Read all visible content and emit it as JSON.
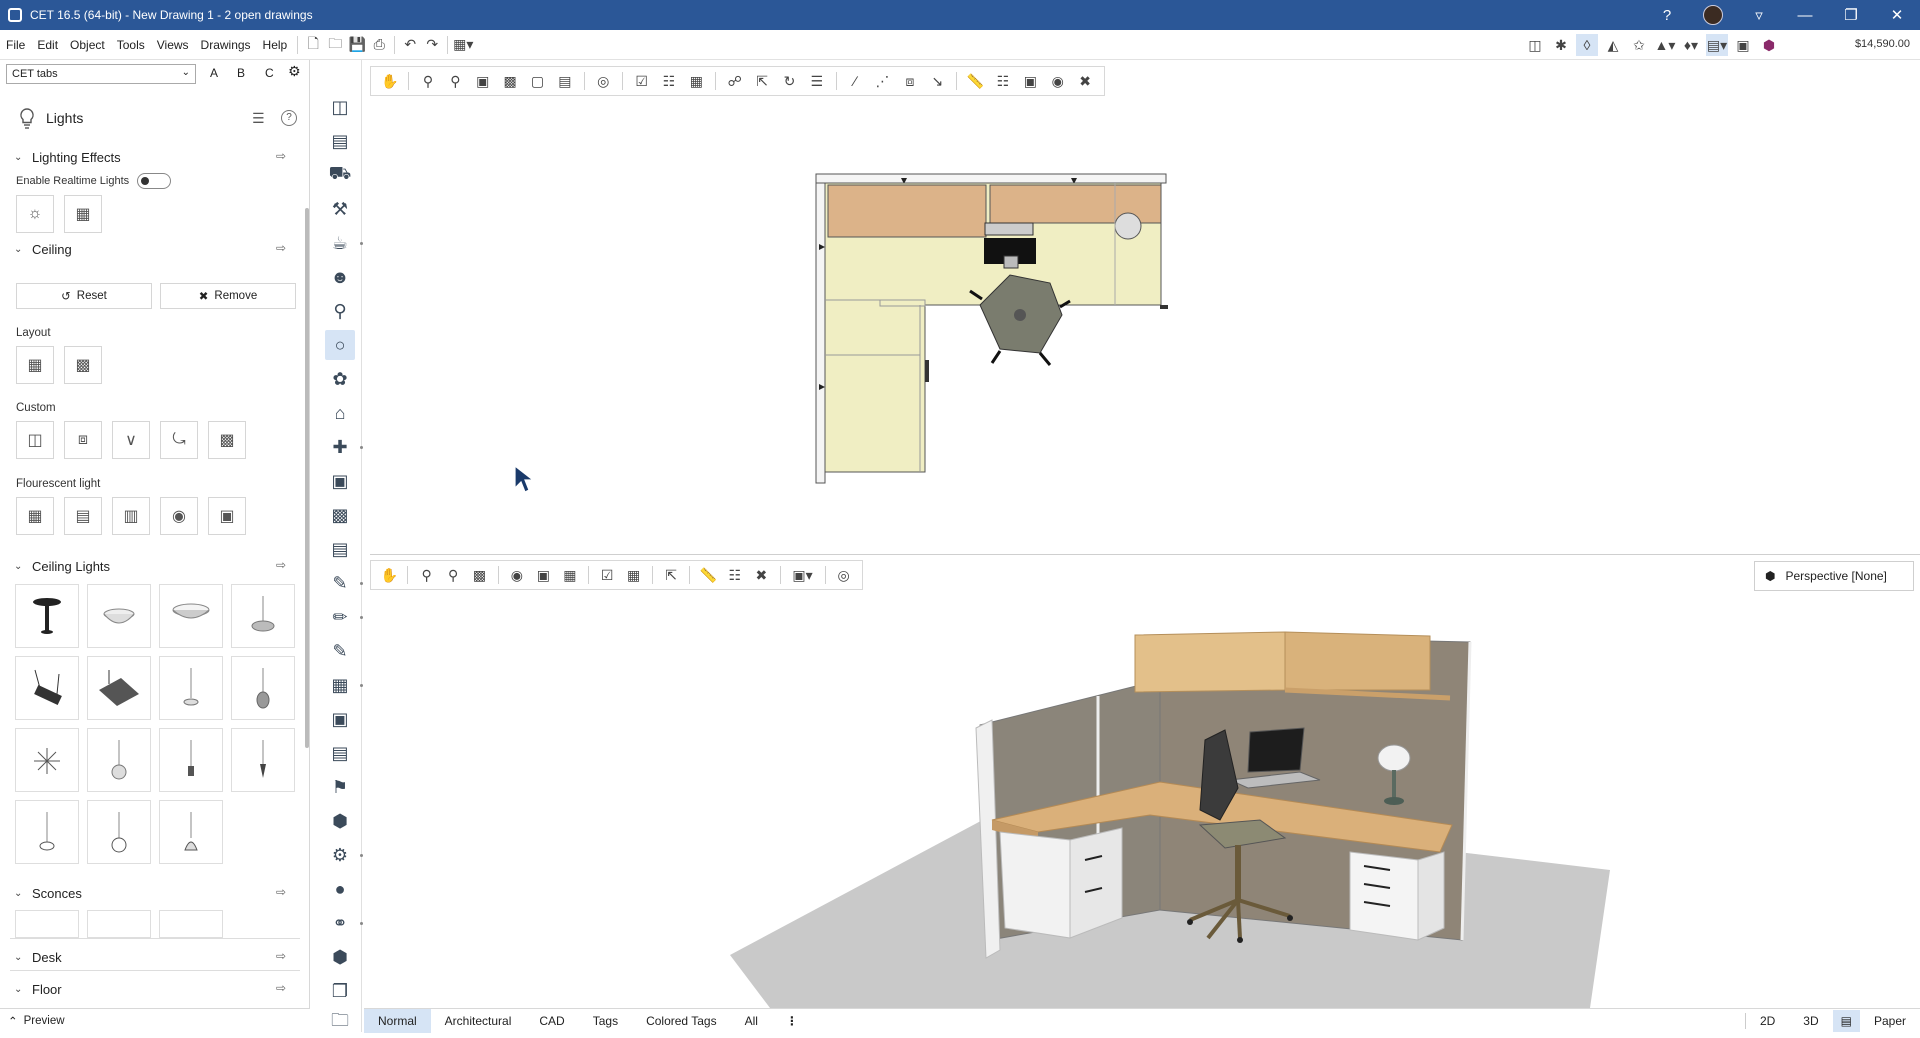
{
  "window": {
    "title": "CET 16.5 (64-bit) - New Drawing 1 - 2  open drawings"
  },
  "menu": {
    "items": [
      "File",
      "Edit",
      "Object",
      "Tools",
      "Views",
      "Drawings",
      "Help"
    ],
    "price": "$14,590.00"
  },
  "panel": {
    "tab_select": "CET tabs",
    "tab_letters": [
      "A",
      "B",
      "C"
    ],
    "title": "Lights",
    "sections": {
      "lighting_effects": "Lighting Effects",
      "enable_realtime": "Enable Realtime Lights",
      "ceiling": "Ceiling",
      "reset": "Reset",
      "remove": "Remove",
      "layout": "Layout",
      "custom": "Custom",
      "fluorescent": "Flourescent light",
      "ceiling_lights": "Ceiling Lights",
      "sconces": "Sconces",
      "desk": "Desk",
      "floor": "Floor"
    },
    "preview": "Preview"
  },
  "view3d": {
    "projection": "Perspective [None]"
  },
  "bottom": {
    "tabs": [
      "Normal",
      "Architectural",
      "CAD",
      "Tags",
      "Colored Tags",
      "All"
    ],
    "active_tab": "Normal",
    "modes": [
      "2D",
      "3D",
      "Paper"
    ]
  },
  "colors": {
    "titlebar": "#2b5797",
    "active_tab": "#d6e4f5",
    "worksurface": "#f0eec3",
    "overhead": "#dcb389"
  }
}
